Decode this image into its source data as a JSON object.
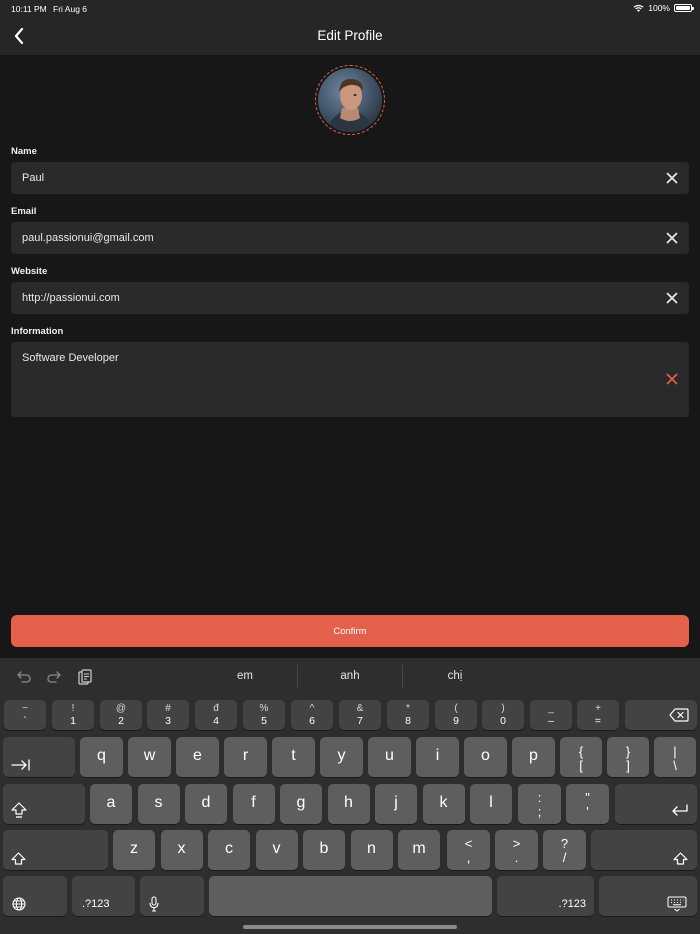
{
  "status": {
    "time": "10:11 PM",
    "date": "Fri Aug 6",
    "battery": "100%"
  },
  "nav": {
    "title": "Edit Profile",
    "back_icon": "chevron-left-icon"
  },
  "colors": {
    "accent": "#e3604c",
    "background": "#171717",
    "field": "#2a2a2a"
  },
  "form": {
    "fields": [
      {
        "label": "Name",
        "value": "Paul"
      },
      {
        "label": "Email",
        "value": "paul.passionui@gmail.com"
      },
      {
        "label": "Website",
        "value": "http://passionui.com"
      },
      {
        "label": "Information",
        "value": "Software Developer"
      }
    ],
    "confirm_label": "Confirm"
  },
  "keyboard": {
    "predictions": [
      "em",
      "anh",
      "chị"
    ],
    "number_row": [
      {
        "top": "~",
        "bottom": "`"
      },
      {
        "top": "!",
        "bottom": "1"
      },
      {
        "top": "@",
        "bottom": "2"
      },
      {
        "top": "#",
        "bottom": "3"
      },
      {
        "top": "đ",
        "bottom": "4"
      },
      {
        "top": "%",
        "bottom": "5"
      },
      {
        "top": "^",
        "bottom": "6"
      },
      {
        "top": "&",
        "bottom": "7"
      },
      {
        "top": "*",
        "bottom": "8"
      },
      {
        "top": "(",
        "bottom": "9"
      },
      {
        "top": ")",
        "bottom": "0"
      },
      {
        "top": "_",
        "bottom": "–"
      },
      {
        "top": "+",
        "bottom": "="
      }
    ],
    "row1": [
      "q",
      "w",
      "e",
      "r",
      "t",
      "y",
      "u",
      "i",
      "o",
      "p"
    ],
    "row1_symbols": [
      {
        "top": "{",
        "bottom": "["
      },
      {
        "top": "}",
        "bottom": "]"
      },
      {
        "top": "|",
        "bottom": "\\"
      }
    ],
    "row2": [
      "a",
      "s",
      "d",
      "f",
      "g",
      "h",
      "j",
      "k",
      "l"
    ],
    "row2_symbols": [
      {
        "top": ":",
        "bottom": ";"
      },
      {
        "top": "\"",
        "bottom": "'"
      }
    ],
    "row3": [
      "z",
      "x",
      "c",
      "v",
      "b",
      "n",
      "m"
    ],
    "row3_symbols": [
      {
        "top": "<",
        "bottom": ","
      },
      {
        "top": ">",
        "bottom": "."
      },
      {
        "top": "?",
        "bottom": "/"
      }
    ],
    "mode_label": ".?123"
  }
}
